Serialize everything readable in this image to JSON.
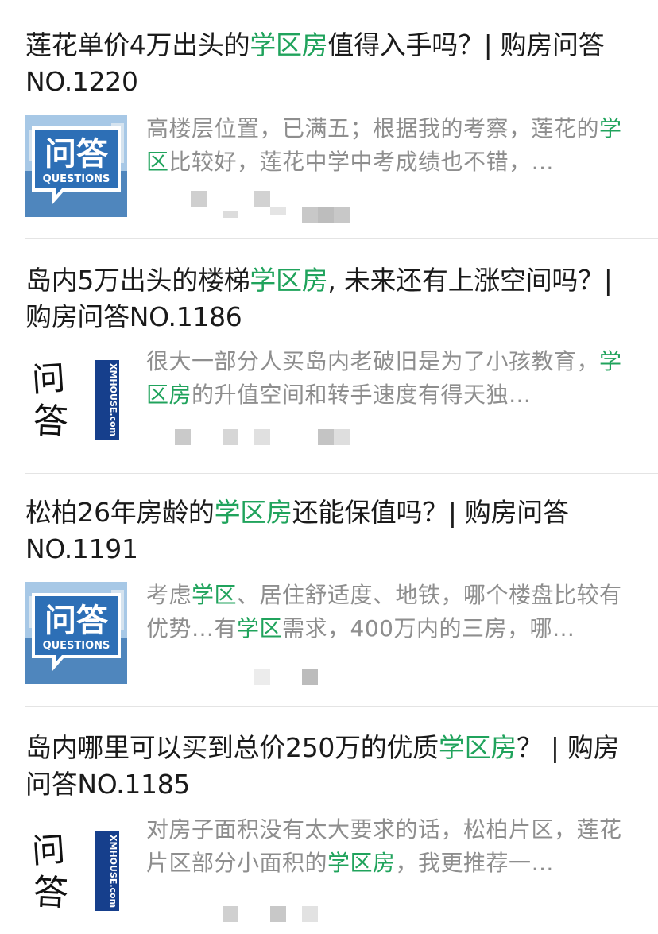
{
  "articles": [
    {
      "title_pre": "莲花单价4万出头的",
      "title_hl": "学区房",
      "title_post": "值得入手吗？| 购房问答NO.1220",
      "thumb": "questions-badge",
      "thumb_text": "问答",
      "thumb_sub": "QUESTIONS",
      "snippet_a": "高楼层位置，已满五；根据我的考察，莲花的",
      "snippet_hl1": "学区",
      "snippet_b": "比较好，莲花中学中考成绩也不错，…",
      "snippet_hl2": "",
      "snippet_c": ""
    },
    {
      "title_pre": "岛内5万出头的楼梯",
      "title_hl": "学区房",
      "title_post": ", 未来还有上涨空间吗？| 购房问答NO.1186",
      "thumb": "calligraphy-logo",
      "thumb_text": "问答",
      "thumb_sub": "XMHOUSE.com",
      "snippet_a": "很大一部分人买岛内老破旧是为了小孩教育，",
      "snippet_hl1": "学区房",
      "snippet_b": "的升值空间和转手速度有得天独…",
      "snippet_hl2": "",
      "snippet_c": ""
    },
    {
      "title_pre": "松柏26年房龄的",
      "title_hl": "学区房",
      "title_post": "还能保值吗？| 购房问答NO.1191",
      "thumb": "questions-badge",
      "thumb_text": "问答",
      "thumb_sub": "QUESTIONS",
      "snippet_a": "考虑",
      "snippet_hl1": "学区",
      "snippet_b": "、居住舒适度、地铁，哪个楼盘比较有优势…有",
      "snippet_hl2": "学区",
      "snippet_c": "需求，400万内的三房，哪…"
    },
    {
      "title_pre": "岛内哪里可以买到总价250万的优质",
      "title_hl": "学区房",
      "title_post": "？ | 购房问答NO.1185",
      "thumb": "calligraphy-logo",
      "thumb_text": "问答",
      "thumb_sub": "XMHOUSE.com",
      "snippet_a": "对房子面积没有太大要求的话，松柏片区，莲花片区部分小面积的",
      "snippet_hl1": "学区房",
      "snippet_b": "，我更推荐一…",
      "snippet_hl2": "",
      "snippet_c": ""
    }
  ],
  "colors": {
    "highlight": "#20a35c",
    "title": "#1a1a1a",
    "snippet": "#8e8e8e",
    "badge_blue": "#2d6fb6"
  }
}
